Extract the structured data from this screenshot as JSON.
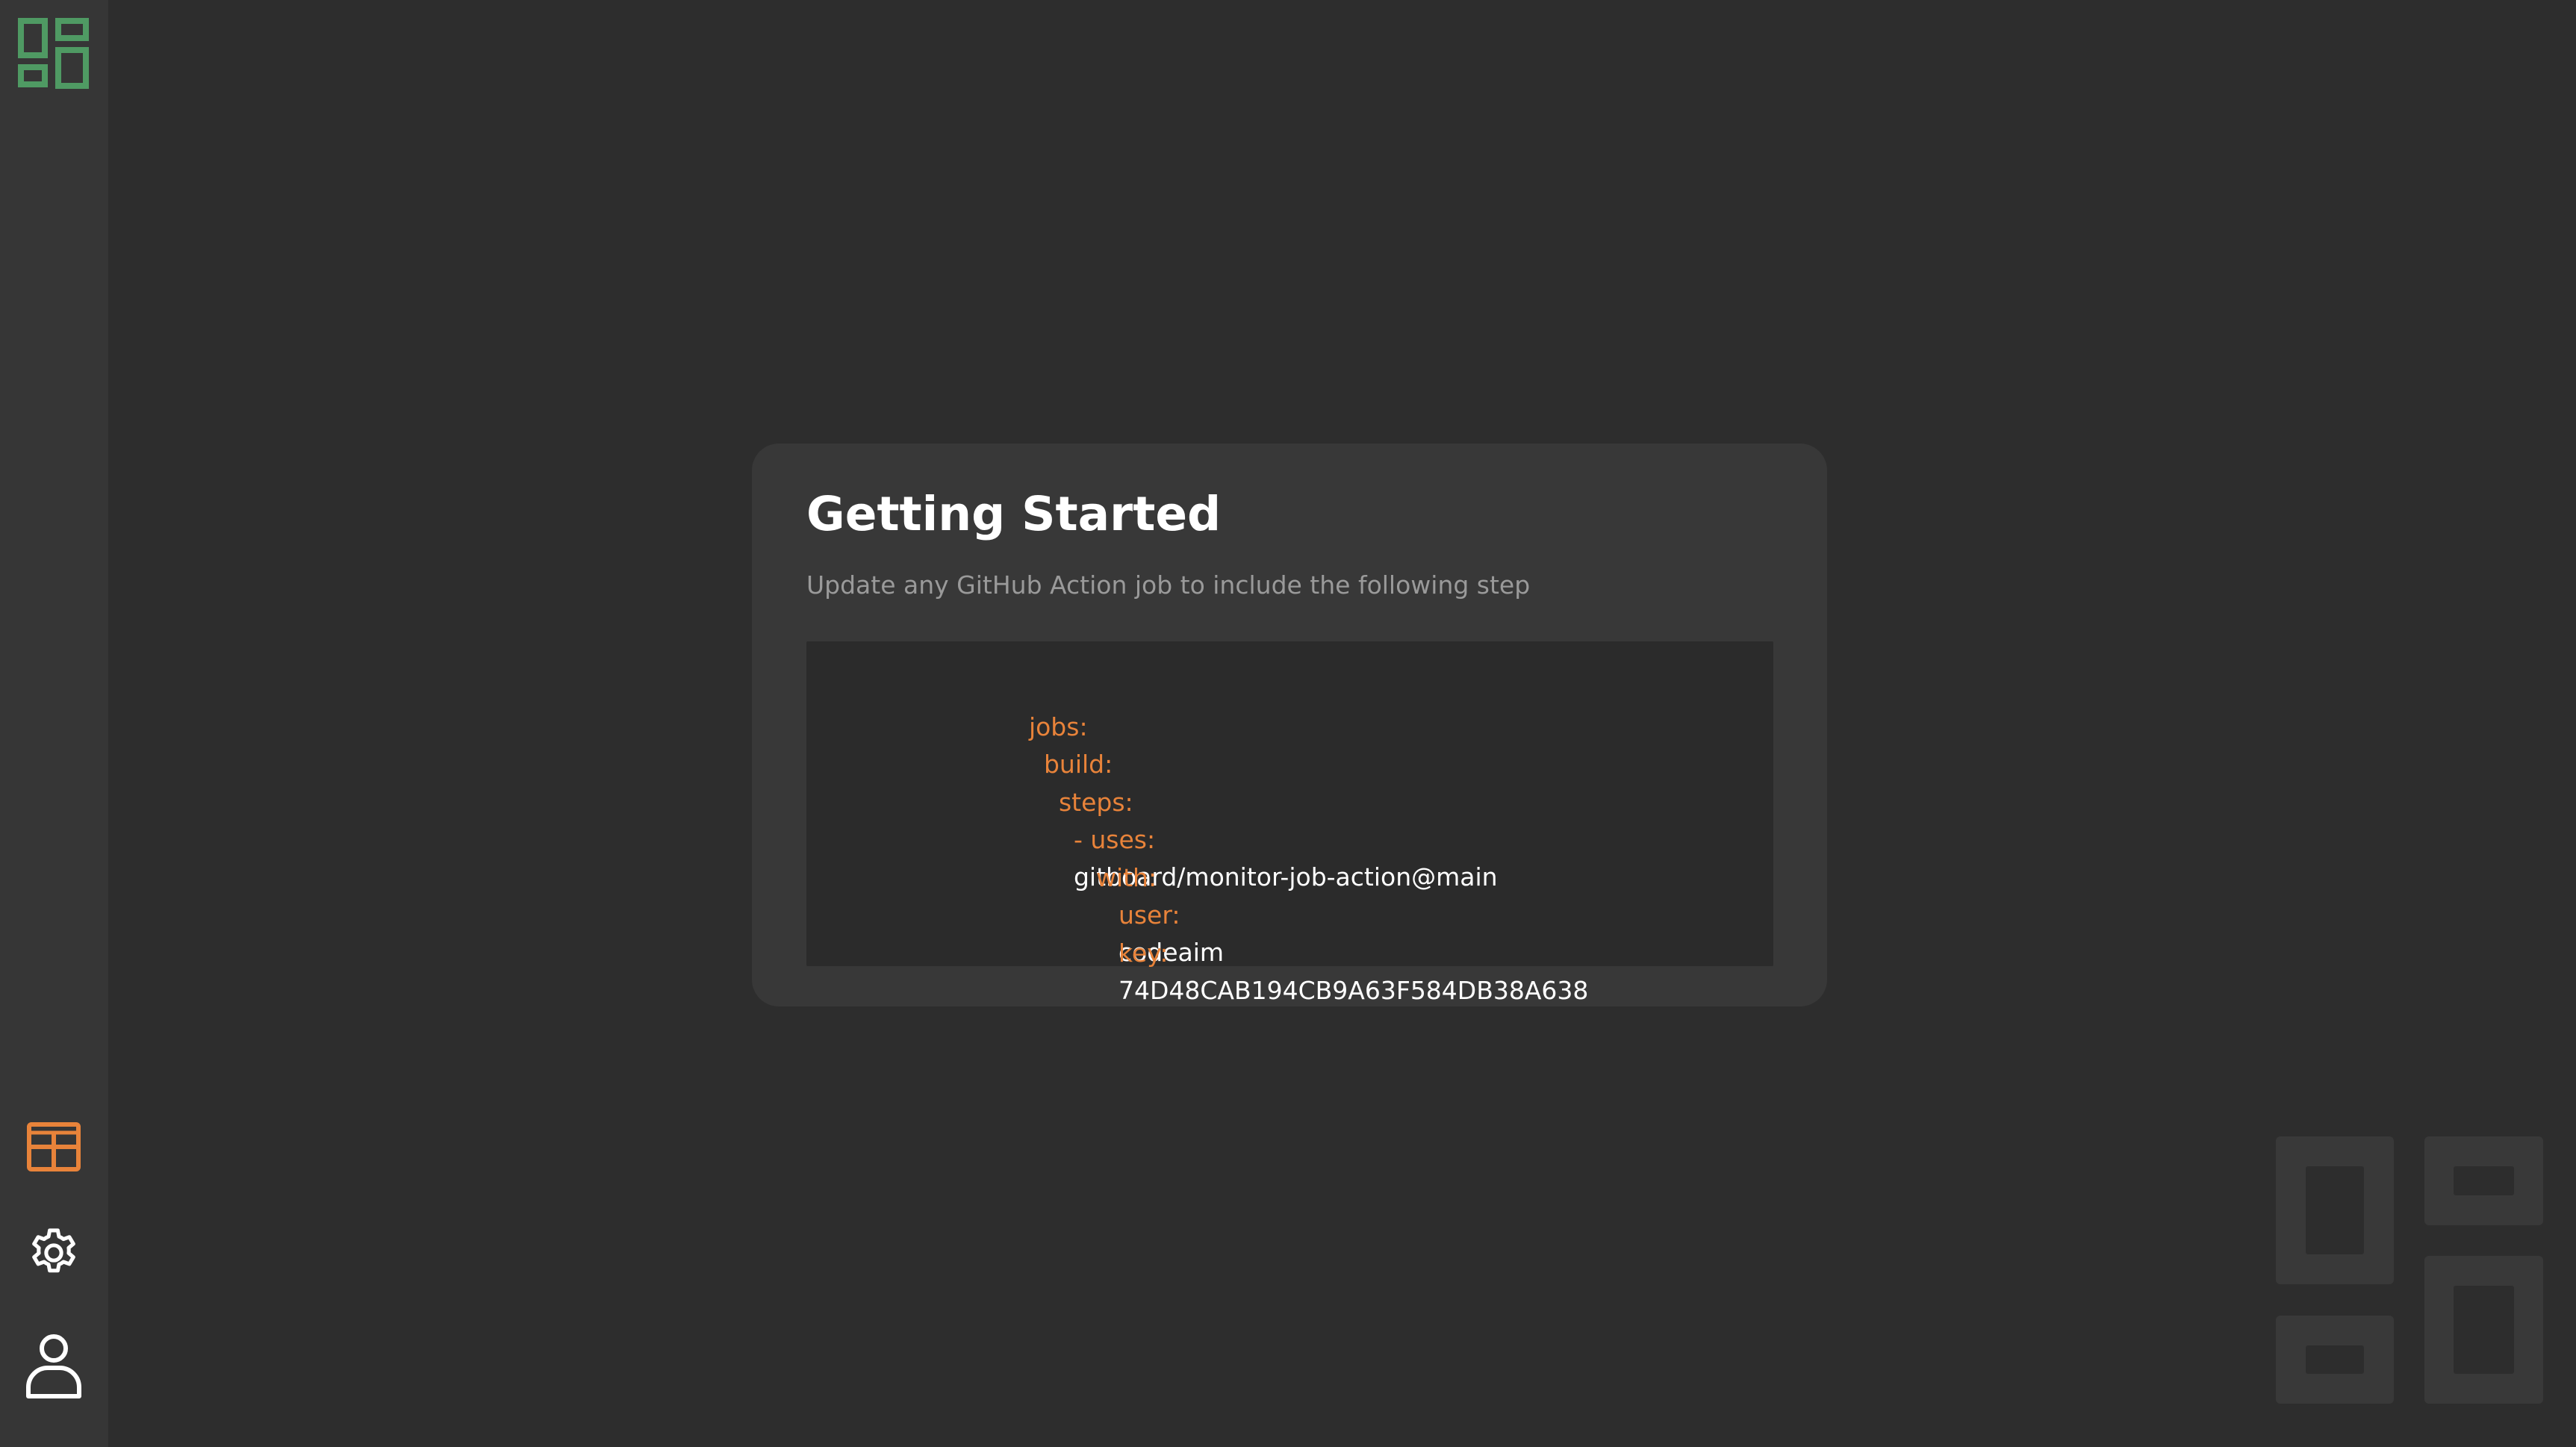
{
  "sidebar": {
    "logo_icon": "grid-logo-icon",
    "logo_color": "#4f9a63",
    "accent_color": "#e8833a",
    "items": [
      {
        "name": "dashboard",
        "icon": "dashboard-grid-icon",
        "active": true
      },
      {
        "name": "settings",
        "icon": "gear-icon",
        "active": false
      },
      {
        "name": "profile",
        "icon": "user-icon",
        "active": false
      }
    ]
  },
  "card": {
    "title": "Getting Started",
    "subtitle": "Update any GitHub Action job to include the following step",
    "code": {
      "jobs_key": "jobs:",
      "build_key": "build:",
      "steps_key": "steps:",
      "uses_key": "- uses:",
      "uses_value": "gitboard/monitor-job-action@main",
      "with_key": "with:",
      "user_key": "user:",
      "user_value": "codeaim",
      "key_key": "key:",
      "key_value": "74D48CAB194CB9A63F584DB38A638"
    }
  }
}
